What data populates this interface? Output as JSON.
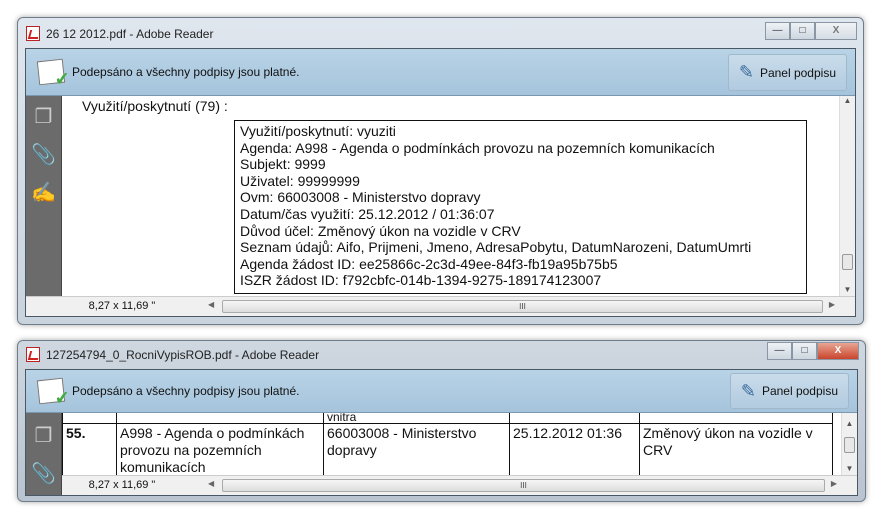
{
  "window1": {
    "title": "26 12 2012.pdf - Adobe Reader",
    "banner": "Podepsáno a všechny podpisy jsou platné.",
    "panel_button": "Panel podpisu",
    "page_size": "8,27 x 11,69 \"",
    "heading": "Využití/poskytnutí (79) :",
    "details": [
      "Využití/poskytnutí: vyuziti",
      "Agenda: A998 - Agenda o podmínkách provozu na pozemních komunikacích",
      "Subjekt: 9999",
      "Uživatel: 99999999",
      "Ovm: 66003008 - Ministerstvo dopravy",
      "Datum/čas využití: 25.12.2012  /  01:36:07",
      "Důvod účel: Změnový úkon na vozidle v CRV",
      "Seznam údajů: Aifo, Prijmeni, Jmeno, AdresaPobytu, DatumNarozeni, DatumUmrti",
      "Agenda žádost ID: ee25866c-2c3d-49ee-84f3-fb19a95b75b5",
      "ISZR žádost ID: f792cbfc-014b-1394-9275-189174123007"
    ]
  },
  "window2": {
    "title": "127254794_0_RocniVypisROB.pdf - Adobe Reader",
    "banner": "Podepsáno a všechny podpisy jsou platné.",
    "panel_button": "Panel podpisu",
    "page_size": "8,27 x 11,69 \"",
    "prev_row_fragment": "vnitra",
    "row": {
      "num": "55.",
      "agenda": "A998 - Agenda o podmínkách provozu na pozemních komunikacích",
      "ovm": "66003008 - Ministerstvo dopravy",
      "datetime": "25.12.2012 01:36",
      "reason": "Změnový úkon na vozidle v CRV"
    }
  },
  "controls": {
    "minimize": "—",
    "maximize": "□",
    "close": "X",
    "scroll_mid": "III",
    "up": "▲",
    "down": "▼",
    "left": "◀",
    "right": "▶"
  }
}
